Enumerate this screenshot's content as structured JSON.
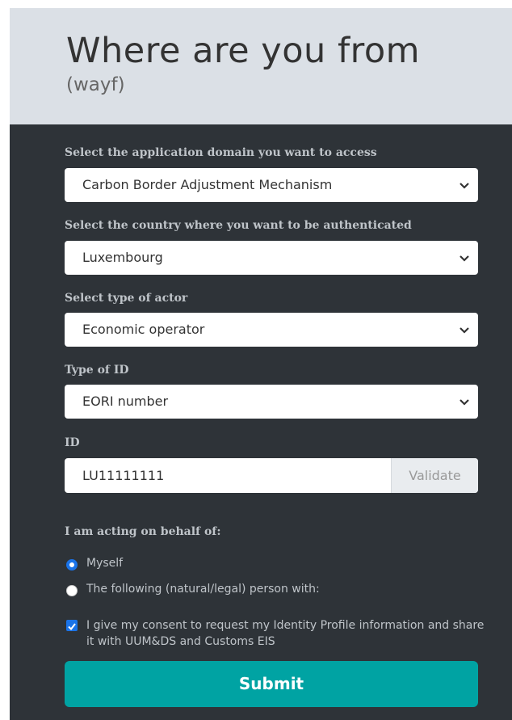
{
  "header": {
    "title": "Where are you from",
    "subtitle": "(wayf)"
  },
  "form": {
    "domain_label": "Select the application domain you want to access",
    "domain_value": "Carbon Border Adjustment Mechanism",
    "country_label": "Select the country where you want to be authenticated",
    "country_value": "Luxembourg",
    "actor_label": "Select type of actor",
    "actor_value": "Economic operator",
    "idtype_label": "Type of ID",
    "idtype_value": "EORI number",
    "id_label": "ID",
    "id_value": "LU11111111",
    "validate_label": "Validate",
    "behalf_label": "I am acting on behalf of:",
    "radio_myself": "Myself",
    "radio_other": "The following (natural/legal) person with:",
    "consent_text": "I give my consent to request my Identity Profile information and share it with UUM&DS and Customs EIS",
    "submit_label": "Submit"
  },
  "state": {
    "selected_radio": "Myself",
    "consent_checked": true
  },
  "colors": {
    "panel_bg": "#2e3338",
    "header_bg": "#dbe0e6",
    "submit_bg": "#00a3a3",
    "accent": "#1a73e8"
  },
  "icons": {
    "select_chevron": "chevron-down-icon",
    "checkbox_check": "check-icon"
  }
}
